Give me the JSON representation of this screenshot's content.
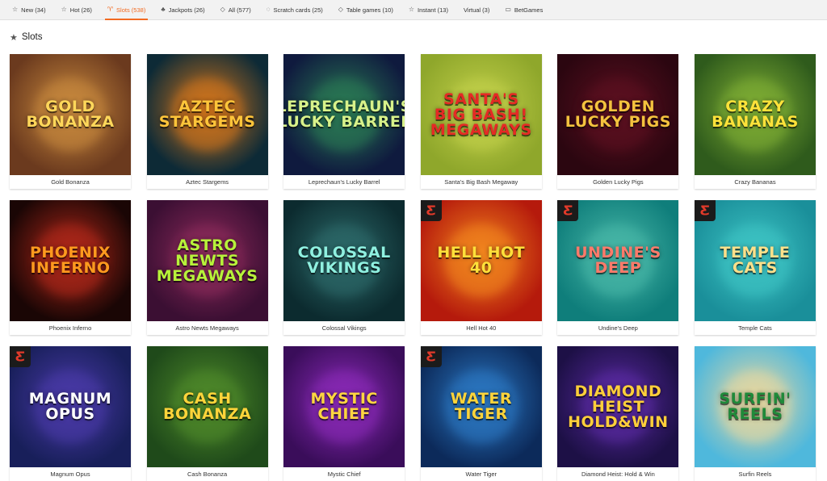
{
  "tabs": [
    {
      "label": "New (34)",
      "icon": "star-outline-icon",
      "glyph": "☆",
      "active": false
    },
    {
      "label": "Hot (26)",
      "icon": "star-outline-icon",
      "glyph": "☆",
      "active": false
    },
    {
      "label": "Slots (538)",
      "icon": "slot-machine-icon",
      "glyph": "♈",
      "active": true
    },
    {
      "label": "Jackpots (26)",
      "icon": "clover-icon",
      "glyph": "♣",
      "active": false
    },
    {
      "label": "All (577)",
      "icon": "diamond-icon",
      "glyph": "◇",
      "active": false
    },
    {
      "label": "Scratch cards (25)",
      "icon": "scratch-card-icon",
      "glyph": "◌",
      "active": false
    },
    {
      "label": "Table games (10)",
      "icon": "diamond-icon",
      "glyph": "◇",
      "active": false
    },
    {
      "label": "Instant (13)",
      "icon": "star-outline-icon",
      "glyph": "☆",
      "active": false
    },
    {
      "label": "Virtual (3)",
      "icon": "",
      "glyph": "",
      "active": false
    },
    {
      "label": "BetGames",
      "icon": "tv-icon",
      "glyph": "▭",
      "active": false
    }
  ],
  "section": {
    "title": "Slots",
    "icon": "star-icon",
    "glyph": "★"
  },
  "accent_color": "#f26a21",
  "games": [
    {
      "name": "Gold Bonanza",
      "art": "GOLD BONANZA",
      "bg": "#6b3a1e",
      "bg2": "#c98a3e",
      "fg": "#ffd75a",
      "badge": false
    },
    {
      "name": "Aztec Stargems",
      "art": "AZTEC STARGEMS",
      "bg": "#0d2a36",
      "bg2": "#d2751c",
      "fg": "#ffc53a",
      "badge": false
    },
    {
      "name": "Leprechaun's Lucky Barrel",
      "art": "Leprechaun's lucky barrel",
      "bg": "#0f1a3e",
      "bg2": "#2a7a54",
      "fg": "#d8f28a",
      "badge": false
    },
    {
      "name": "Santa's Big Bash Megaway",
      "art": "SANTA'S BIG BASH! MEGAWAYS",
      "bg": "#8fa72b",
      "bg2": "#c2d04a",
      "fg": "#e52a25",
      "badge": false
    },
    {
      "name": "Golden Lucky Pigs",
      "art": "GOLDEN LUCKY PIGS",
      "bg": "#2b0610",
      "bg2": "#5c1020",
      "fg": "#f4c23e",
      "badge": false
    },
    {
      "name": "Crazy Bananas",
      "art": "CRAZY BANANAS",
      "bg": "#2f5b1c",
      "bg2": "#7fae34",
      "fg": "#ffe23a",
      "badge": false
    },
    {
      "name": "Phoenix Inferno",
      "art": "PHOENIX INFERNO",
      "bg": "#1a0605",
      "bg2": "#b2281a",
      "fg": "#ff9a1e",
      "badge": false
    },
    {
      "name": "Astro Newts Megaways",
      "art": "ASTRO NEWTS MEGAWAYS",
      "bg": "#3b0f33",
      "bg2": "#8b2a5a",
      "fg": "#b7f23a",
      "badge": false
    },
    {
      "name": "Colossal Vikings",
      "art": "COLOSSAL VIKINGS",
      "bg": "#0c2b2f",
      "bg2": "#2d6a6a",
      "fg": "#8ff0e0",
      "badge": false
    },
    {
      "name": "Hell Hot 40",
      "art": "HELL HOT 40",
      "bg": "#b51a0c",
      "bg2": "#f2861e",
      "fg": "#ffe03a",
      "badge": true
    },
    {
      "name": "Undine's Deep",
      "art": "UNDINE'S DEEP",
      "bg": "#0f7e7b",
      "bg2": "#49b8a8",
      "fg": "#ff7a6a",
      "badge": true
    },
    {
      "name": "Temple Cats",
      "art": "TEMPLE CATS",
      "bg": "#1a8f9a",
      "bg2": "#3ec4c4",
      "fg": "#ffe08a",
      "badge": true
    },
    {
      "name": "Magnum Opus",
      "art": "MAGNUM OPUS",
      "bg": "#181f5a",
      "bg2": "#4a3aa8",
      "fg": "#ffffff",
      "badge": true
    },
    {
      "name": "Cash Bonanza",
      "art": "CASH BONANZA",
      "bg": "#1f4a1a",
      "bg2": "#4f8a2a",
      "fg": "#ffd43a",
      "badge": false
    },
    {
      "name": "Mystic Chief",
      "art": "MYSTIC CHIEF",
      "bg": "#3a0d5a",
      "bg2": "#8b2ab8",
      "fg": "#ffd640",
      "badge": false
    },
    {
      "name": "Water Tiger",
      "art": "WATER TIGER",
      "bg": "#0c2a5a",
      "bg2": "#2c79c4",
      "fg": "#ffd43a",
      "badge": true
    },
    {
      "name": "Diamond Heist: Hold & Win",
      "art": "DIAMOND HEIST HOLD&WIN",
      "bg": "#1d1046",
      "bg2": "#5a2aa2",
      "fg": "#ffcf3a",
      "badge": false
    },
    {
      "name": "Surfin Reels",
      "art": "SURFIN' REELS",
      "bg": "#4fb8dc",
      "bg2": "#e8d8a0",
      "fg": "#1f8a3a",
      "badge": false
    }
  ]
}
